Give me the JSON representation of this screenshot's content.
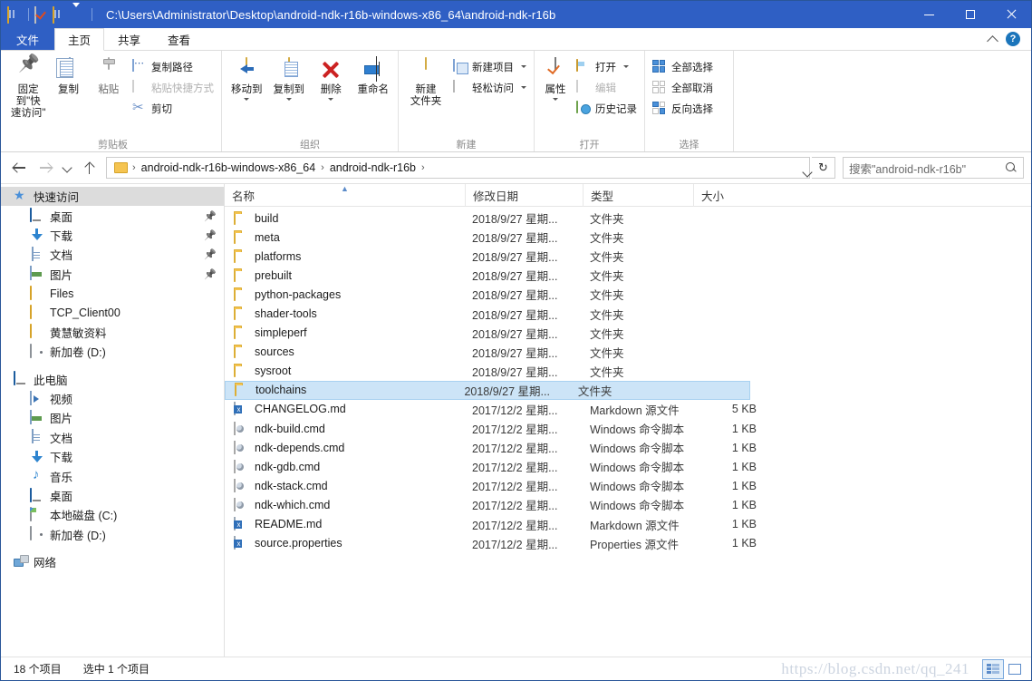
{
  "window": {
    "path_title": "C:\\Users\\Administrator\\Desktop\\android-ndk-r16b-windows-x86_64\\android-ndk-r16b",
    "minimize_label": "最小化",
    "maximize_label": "最大化",
    "close_label": "关闭",
    "accent_color": "#2f5fc4"
  },
  "quick_access_toolbar": {
    "items": [
      {
        "name": "explorer-icon",
        "label": "资源管理器"
      },
      {
        "name": "properties-icon",
        "label": "属性"
      },
      {
        "name": "new-folder-icon",
        "label": "新建文件夹"
      },
      {
        "name": "customize-dropdown",
        "label": "自定义快速访问工具栏"
      }
    ]
  },
  "ribbon": {
    "tabs": [
      {
        "id": "file",
        "label": "文件"
      },
      {
        "id": "home",
        "label": "主页"
      },
      {
        "id": "share",
        "label": "共享"
      },
      {
        "id": "view",
        "label": "查看"
      }
    ],
    "active_tab": "home",
    "collapse_label": "展开/折叠功能区",
    "help_label": "?",
    "groups": [
      {
        "id": "clipboard",
        "label": "剪贴板",
        "big_buttons": [
          {
            "id": "pin-to-quick-access",
            "label_line1": "固定到\"快",
            "label_line2": "速访问\"",
            "icon": "pin-icon"
          },
          {
            "id": "copy",
            "label_line1": "复制",
            "label_line2": "",
            "icon": "copy-icon"
          },
          {
            "id": "paste",
            "label_line1": "粘贴",
            "label_line2": "",
            "icon": "paste-icon"
          }
        ],
        "small_buttons": [
          {
            "id": "copy-path",
            "label": "复制路径",
            "icon": "copy-path-icon",
            "disabled": false
          },
          {
            "id": "paste-shortcut",
            "label": "粘贴快捷方式",
            "icon": "paste-shortcut-icon",
            "disabled": true
          },
          {
            "id": "cut",
            "label": "剪切",
            "icon": "scissors-icon",
            "disabled": false
          }
        ]
      },
      {
        "id": "organize",
        "label": "组织",
        "big_buttons": [
          {
            "id": "move-to",
            "label_line1": "移动到",
            "label_line2": "",
            "icon": "move-to-icon",
            "has_dropdown": true
          },
          {
            "id": "copy-to",
            "label_line1": "复制到",
            "label_line2": "",
            "icon": "copy-to-icon",
            "has_dropdown": true
          },
          {
            "id": "delete",
            "label_line1": "删除",
            "label_line2": "",
            "icon": "delete-icon",
            "has_dropdown": true
          },
          {
            "id": "rename",
            "label_line1": "重命名",
            "label_line2": "",
            "icon": "rename-icon"
          }
        ]
      },
      {
        "id": "new",
        "label": "新建",
        "big_buttons": [
          {
            "id": "new-folder",
            "label_line1": "新建",
            "label_line2": "文件夹",
            "icon": "new-folder-icon"
          }
        ],
        "small_buttons": [
          {
            "id": "new-item",
            "label": "新建项目",
            "icon": "new-item-icon",
            "has_dropdown": true
          },
          {
            "id": "easy-access",
            "label": "轻松访问",
            "icon": "easy-access-icon",
            "has_dropdown": true
          }
        ]
      },
      {
        "id": "open",
        "label": "打开",
        "big_buttons": [
          {
            "id": "properties",
            "label_line1": "属性",
            "label_line2": "",
            "icon": "properties-icon",
            "has_dropdown": true
          }
        ],
        "small_buttons": [
          {
            "id": "open",
            "label": "打开",
            "icon": "open-icon",
            "has_dropdown": true
          },
          {
            "id": "edit",
            "label": "编辑",
            "icon": "edit-icon",
            "disabled": true
          },
          {
            "id": "history",
            "label": "历史记录",
            "icon": "history-icon"
          }
        ]
      },
      {
        "id": "select",
        "label": "选择",
        "small_buttons": [
          {
            "id": "select-all",
            "label": "全部选择",
            "icon": "select-all-icon"
          },
          {
            "id": "select-none",
            "label": "全部取消",
            "icon": "select-none-icon"
          },
          {
            "id": "invert-selection",
            "label": "反向选择",
            "icon": "invert-selection-icon"
          }
        ]
      }
    ]
  },
  "addressbar": {
    "back_label": "后退",
    "forward_label": "前进",
    "recent_label": "最近浏览的位置",
    "up_label": "上移到",
    "breadcrumbs": [
      "android-ndk-r16b-windows-x86_64",
      "android-ndk-r16b"
    ],
    "refresh_label": "刷新",
    "search_placeholder": "搜索\"android-ndk-r16b\""
  },
  "sidebar": {
    "items": [
      {
        "label": "快速访问",
        "icon": "star-icon",
        "level": 0,
        "selected": true,
        "pinned": false
      },
      {
        "label": "桌面",
        "icon": "desktop-icon",
        "level": 1,
        "selected": false,
        "pinned": true
      },
      {
        "label": "下载",
        "icon": "downloads-icon",
        "level": 1,
        "selected": false,
        "pinned": true
      },
      {
        "label": "文档",
        "icon": "documents-icon",
        "level": 1,
        "selected": false,
        "pinned": true
      },
      {
        "label": "图片",
        "icon": "pictures-icon",
        "level": 1,
        "selected": false,
        "pinned": true
      },
      {
        "label": "Files",
        "icon": "folder-icon",
        "level": 1,
        "selected": false,
        "pinned": false
      },
      {
        "label": "TCP_Client00",
        "icon": "folder-icon",
        "level": 1,
        "selected": false,
        "pinned": false
      },
      {
        "label": "黄慧敏资料",
        "icon": "folder-icon",
        "level": 1,
        "selected": false,
        "pinned": false
      },
      {
        "label": "新加卷 (D:)",
        "icon": "drive-icon",
        "level": 1,
        "selected": false,
        "pinned": false
      },
      {
        "label": "__GAP__",
        "icon": "",
        "level": 0,
        "selected": false,
        "pinned": false
      },
      {
        "label": "此电脑",
        "icon": "this-pc-icon",
        "level": 0,
        "selected": false,
        "pinned": false
      },
      {
        "label": "视频",
        "icon": "videos-icon",
        "level": 1,
        "selected": false,
        "pinned": false
      },
      {
        "label": "图片",
        "icon": "pictures-icon",
        "level": 1,
        "selected": false,
        "pinned": false
      },
      {
        "label": "文档",
        "icon": "documents-icon",
        "level": 1,
        "selected": false,
        "pinned": false
      },
      {
        "label": "下载",
        "icon": "downloads-icon",
        "level": 1,
        "selected": false,
        "pinned": false
      },
      {
        "label": "音乐",
        "icon": "music-icon",
        "level": 1,
        "selected": false,
        "pinned": false
      },
      {
        "label": "桌面",
        "icon": "desktop-icon",
        "level": 1,
        "selected": false,
        "pinned": false
      },
      {
        "label": "本地磁盘 (C:)",
        "icon": "system-drive-icon",
        "level": 1,
        "selected": false,
        "pinned": false
      },
      {
        "label": "新加卷 (D:)",
        "icon": "drive-icon",
        "level": 1,
        "selected": false,
        "pinned": false
      },
      {
        "label": "__GAP__",
        "icon": "",
        "level": 0,
        "selected": false,
        "pinned": false
      },
      {
        "label": "网络",
        "icon": "network-icon",
        "level": 0,
        "selected": false,
        "pinned": false
      }
    ]
  },
  "filelist": {
    "columns": [
      {
        "id": "name",
        "label": "名称",
        "sorted": true,
        "sort_dir": "asc"
      },
      {
        "id": "date",
        "label": "修改日期",
        "sorted": false
      },
      {
        "id": "type",
        "label": "类型",
        "sorted": false
      },
      {
        "id": "size",
        "label": "大小",
        "sorted": false
      }
    ],
    "rows": [
      {
        "name": "build",
        "date": "2018/9/27 星期...",
        "type": "文件夹",
        "size": "",
        "icon": "folder-icon",
        "selected": false
      },
      {
        "name": "meta",
        "date": "2018/9/27 星期...",
        "type": "文件夹",
        "size": "",
        "icon": "folder-icon",
        "selected": false
      },
      {
        "name": "platforms",
        "date": "2018/9/27 星期...",
        "type": "文件夹",
        "size": "",
        "icon": "folder-icon",
        "selected": false
      },
      {
        "name": "prebuilt",
        "date": "2018/9/27 星期...",
        "type": "文件夹",
        "size": "",
        "icon": "folder-icon",
        "selected": false
      },
      {
        "name": "python-packages",
        "date": "2018/9/27 星期...",
        "type": "文件夹",
        "size": "",
        "icon": "folder-icon",
        "selected": false
      },
      {
        "name": "shader-tools",
        "date": "2018/9/27 星期...",
        "type": "文件夹",
        "size": "",
        "icon": "folder-icon",
        "selected": false
      },
      {
        "name": "simpleperf",
        "date": "2018/9/27 星期...",
        "type": "文件夹",
        "size": "",
        "icon": "folder-icon",
        "selected": false
      },
      {
        "name": "sources",
        "date": "2018/9/27 星期...",
        "type": "文件夹",
        "size": "",
        "icon": "folder-icon",
        "selected": false
      },
      {
        "name": "sysroot",
        "date": "2018/9/27 星期...",
        "type": "文件夹",
        "size": "",
        "icon": "folder-icon",
        "selected": false
      },
      {
        "name": "toolchains",
        "date": "2018/9/27 星期...",
        "type": "文件夹",
        "size": "",
        "icon": "folder-icon",
        "selected": true
      },
      {
        "name": "CHANGELOG.md",
        "date": "2017/12/2 星期...",
        "type": "Markdown 源文件",
        "size": "5 KB",
        "icon": "markdown-file-icon",
        "selected": false
      },
      {
        "name": "ndk-build.cmd",
        "date": "2017/12/2 星期...",
        "type": "Windows 命令脚本",
        "size": "1 KB",
        "icon": "cmd-file-icon",
        "selected": false
      },
      {
        "name": "ndk-depends.cmd",
        "date": "2017/12/2 星期...",
        "type": "Windows 命令脚本",
        "size": "1 KB",
        "icon": "cmd-file-icon",
        "selected": false
      },
      {
        "name": "ndk-gdb.cmd",
        "date": "2017/12/2 星期...",
        "type": "Windows 命令脚本",
        "size": "1 KB",
        "icon": "cmd-file-icon",
        "selected": false
      },
      {
        "name": "ndk-stack.cmd",
        "date": "2017/12/2 星期...",
        "type": "Windows 命令脚本",
        "size": "1 KB",
        "icon": "cmd-file-icon",
        "selected": false
      },
      {
        "name": "ndk-which.cmd",
        "date": "2017/12/2 星期...",
        "type": "Windows 命令脚本",
        "size": "1 KB",
        "icon": "cmd-file-icon",
        "selected": false
      },
      {
        "name": "README.md",
        "date": "2017/12/2 星期...",
        "type": "Markdown 源文件",
        "size": "1 KB",
        "icon": "markdown-file-icon",
        "selected": false
      },
      {
        "name": "source.properties",
        "date": "2017/12/2 星期...",
        "type": "Properties 源文件",
        "size": "1 KB",
        "icon": "properties-file-icon",
        "selected": false
      }
    ],
    "selection_highlight_color": "#cce4f7"
  },
  "statusbar": {
    "item_count": "18 个项目",
    "selection": "选中 1 个项目",
    "watermark": "https://blog.csdn.net/qq_241",
    "views": [
      {
        "id": "details-view",
        "label": "详细信息",
        "active": true
      },
      {
        "id": "large-icons-view",
        "label": "大图标",
        "active": false
      }
    ]
  }
}
